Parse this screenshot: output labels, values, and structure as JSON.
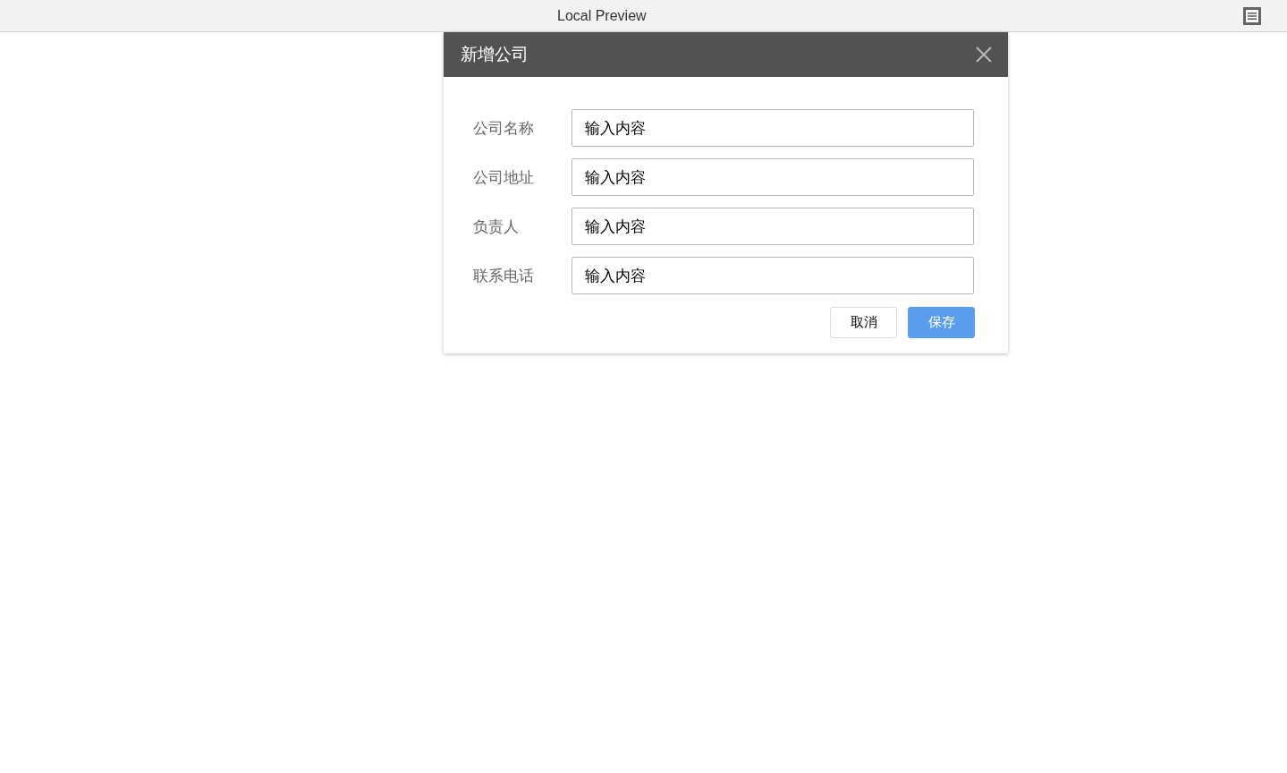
{
  "window": {
    "title": "Local Preview"
  },
  "dialog": {
    "title": "新增公司",
    "fields": [
      {
        "label": "公司名称",
        "value": "输入内容"
      },
      {
        "label": "公司地址",
        "value": "输入内容"
      },
      {
        "label": "负责人",
        "value": "输入内容"
      },
      {
        "label": "联系电话",
        "value": "输入内容"
      }
    ],
    "buttons": [
      {
        "label": "取消",
        "kind": "default"
      },
      {
        "label": "保存",
        "kind": "primary"
      }
    ]
  }
}
